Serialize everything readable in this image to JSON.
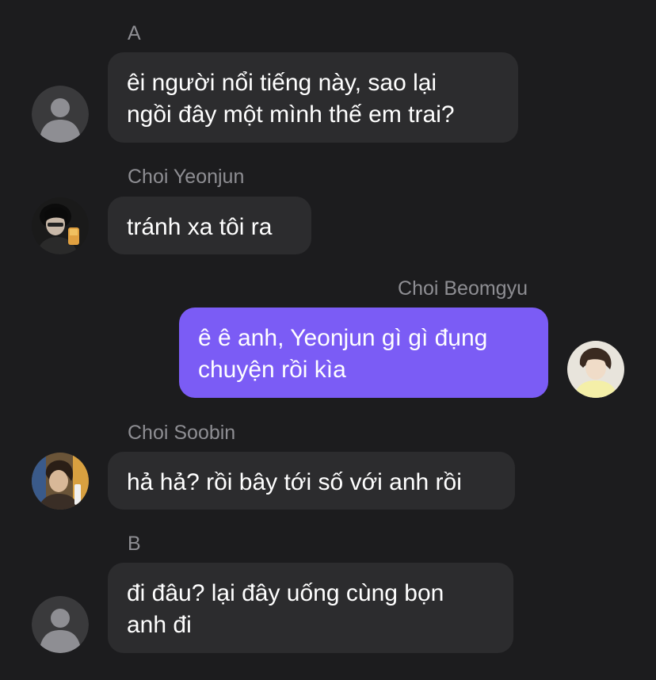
{
  "messages": [
    {
      "sender": "A",
      "lines": [
        "êi người nổi tiếng này, sao lại",
        "ngồi đây một mình thế em trai?"
      ],
      "direction": "incoming",
      "avatar": "default-person-icon"
    },
    {
      "sender": "Choi Yeonjun",
      "lines": [
        "tránh xa tôi ra"
      ],
      "direction": "incoming",
      "avatar": "photo-avatar"
    },
    {
      "sender": "Choi Beomgyu",
      "lines": [
        "ê ê anh, Yeonjun gì gì đụng",
        "chuyện rồi kìa"
      ],
      "direction": "outgoing",
      "avatar": "photo-avatar"
    },
    {
      "sender": "Choi Soobin",
      "lines": [
        "hả hả? rồi bây tới số với anh rồi"
      ],
      "direction": "incoming",
      "avatar": "photo-avatar"
    },
    {
      "sender": "B",
      "lines": [
        "đi đâu? lại đây uống cùng bọn",
        "anh đi"
      ],
      "direction": "incoming",
      "avatar": "default-person-icon"
    }
  ],
  "colors": {
    "background": "#1c1c1e",
    "incoming_bubble": "#2c2c2e",
    "outgoing_bubble": "#7b5cf5",
    "sender_name": "#8e8e93",
    "message_text": "#ffffff"
  }
}
